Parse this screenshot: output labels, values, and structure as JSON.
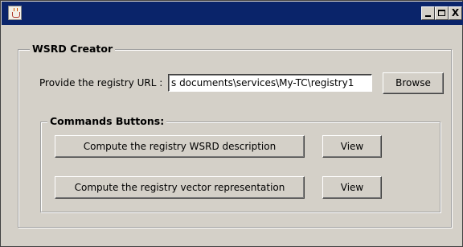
{
  "window": {
    "title": "",
    "app_icon": "java-cup-icon",
    "controls": {
      "minimize": "minimize-icon",
      "maximize": "maximize-icon",
      "close_label": "X"
    }
  },
  "creator": {
    "title": "WSRD Creator",
    "url_label": "Provide the registry URL :",
    "url_value": "s documents\\services\\My-TC\\registry1",
    "browse_label": "Browse"
  },
  "commands": {
    "title": "Commands Buttons:",
    "compute_wsrd_label": "Compute the registry WSRD description",
    "view_wsrd_label": "View",
    "compute_vector_label": "Compute the registry vector representation",
    "view_vector_label": "View"
  },
  "colors": {
    "titlebar": "#0a246a",
    "face": "#d4d0c8"
  }
}
